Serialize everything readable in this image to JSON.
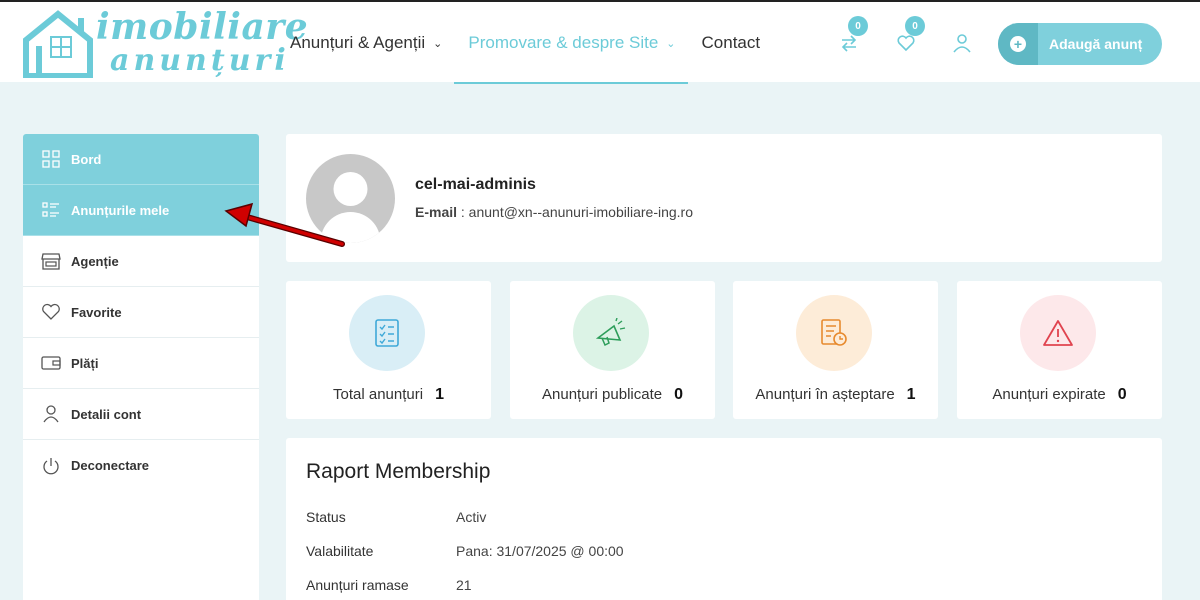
{
  "logo": {
    "line1": "imobiliare",
    "line2": "anunțuri"
  },
  "nav": {
    "items": [
      {
        "label": "Anunțuri & Agenții"
      },
      {
        "label": "Promovare & despre Site"
      },
      {
        "label": "Contact"
      }
    ]
  },
  "header": {
    "compare_count": "0",
    "favorites_count": "0",
    "add_button": "Adaugă anunț"
  },
  "sidebar": {
    "items": [
      {
        "label": "Bord",
        "icon": "dashboard-icon"
      },
      {
        "label": "Anunțurile mele",
        "icon": "list-icon"
      },
      {
        "label": "Agenție",
        "icon": "store-icon"
      },
      {
        "label": "Favorite",
        "icon": "heart-icon"
      },
      {
        "label": "Plăți",
        "icon": "wallet-icon"
      },
      {
        "label": "Detalii cont",
        "icon": "user-icon"
      },
      {
        "label": "Deconectare",
        "icon": "power-icon"
      }
    ]
  },
  "profile": {
    "username": "cel-mai-adminis",
    "email_label": "E-mail",
    "email_value": " : anunt@xn--anunuri-imobiliare-ing.ro"
  },
  "stats": [
    {
      "label": "Total anunțuri",
      "value": "1",
      "color": "#d9eef6"
    },
    {
      "label": "Anunțuri publicate",
      "value": "0",
      "color": "#dcf3e6"
    },
    {
      "label": "Anunțuri în așteptare",
      "value": "1",
      "color": "#fdecd8"
    },
    {
      "label": "Anunțuri expirate",
      "value": "0",
      "color": "#fde8ea"
    }
  ],
  "membership": {
    "title": "Raport Membership",
    "rows": [
      {
        "key": "Status",
        "value": "Activ"
      },
      {
        "key": "Valabilitate",
        "value": "Pana: 31/07/2025 @ 00:00"
      },
      {
        "key": "Anunțuri ramase",
        "value": "21"
      }
    ]
  },
  "colors": {
    "accent": "#7fd0dc",
    "accent_dark": "#5fb8c4",
    "background": "#eaf4f6",
    "arrow": "#c40000"
  }
}
